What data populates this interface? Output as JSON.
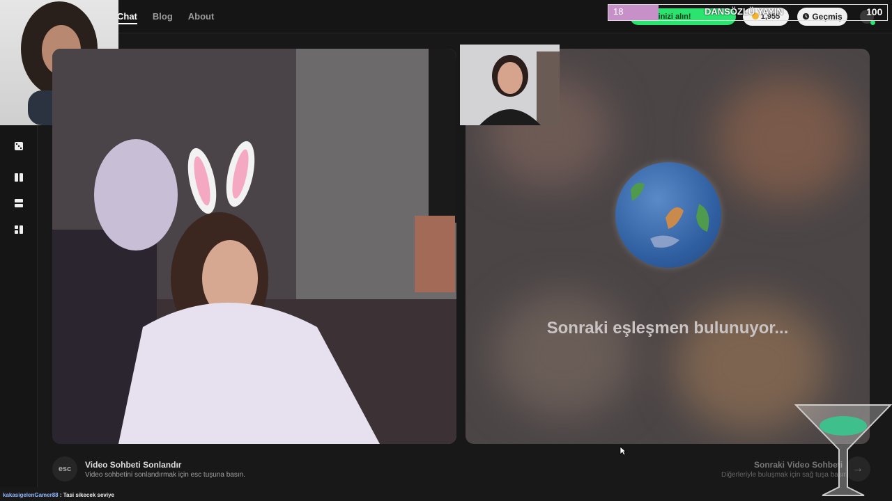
{
  "nav": {
    "items": [
      {
        "label": "Chat"
      },
      {
        "label": "Blog"
      },
      {
        "label": "About"
      }
    ]
  },
  "header": {
    "promo_label": "llerinizi alın!",
    "coins_value": "1,955",
    "history_label": "Geçmiş"
  },
  "overlay": {
    "progress_value": "18",
    "progress_goal": "100",
    "progress_fraction": 0.18,
    "title": "DANSÖZLÜ YAYIN"
  },
  "main": {
    "searching_text": "Sonraki eşleşmen bulunuyor..."
  },
  "footer": {
    "esc_key": "esc",
    "end_title": "Video Sohbeti Sonlandır",
    "end_sub": "Video sohbetini sonlandırmak için esc tuşuna basın.",
    "next_title": "Sonraki Video Sohbeti",
    "next_sub": "Diğerleriyle buluşmak için sağ tuşa basın",
    "next_arrow": "→"
  },
  "chat": {
    "user": "kakasigelenGamer88",
    "separator": " : ",
    "message": "Tasi sikecek seviye"
  },
  "colors": {
    "accent_green": "#2be36f",
    "overlay_fill": "#c890c9",
    "background": "#181818"
  },
  "icons": [
    "dice-icon",
    "layout-split-vertical-icon",
    "layout-split-horizontal-icon",
    "layout-grid-icon",
    "clock-icon",
    "coin-icon",
    "globe-icon",
    "arrow-right-icon",
    "cursor-icon"
  ]
}
